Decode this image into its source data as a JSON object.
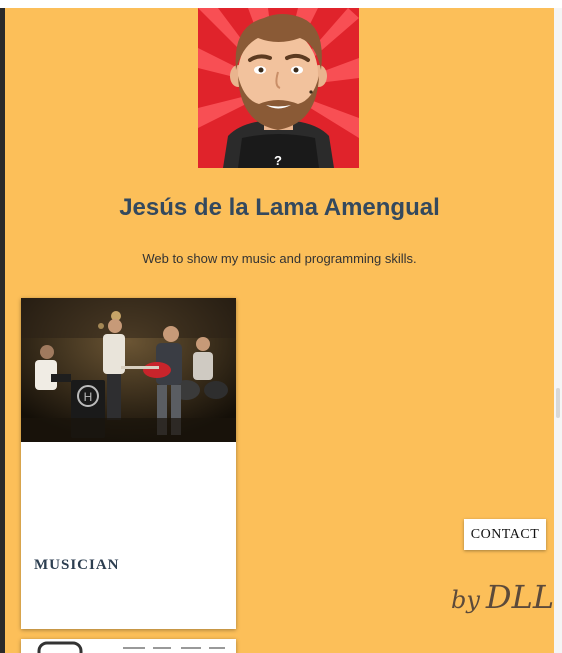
{
  "profile": {
    "name": "Jesús de la Lama Amengual",
    "tagline": "Web to show my music and programming skills.",
    "avatar_badge": "?"
  },
  "cards": [
    {
      "title": "MUSICIAN"
    }
  ],
  "contact_label": "CONTACT",
  "signature": {
    "by": "by",
    "initials": "DLL"
  },
  "colors": {
    "page_background": "#fcbf59",
    "title": "#34495e",
    "card_background": "#ffffff",
    "avatar_background": "#e0232b"
  }
}
